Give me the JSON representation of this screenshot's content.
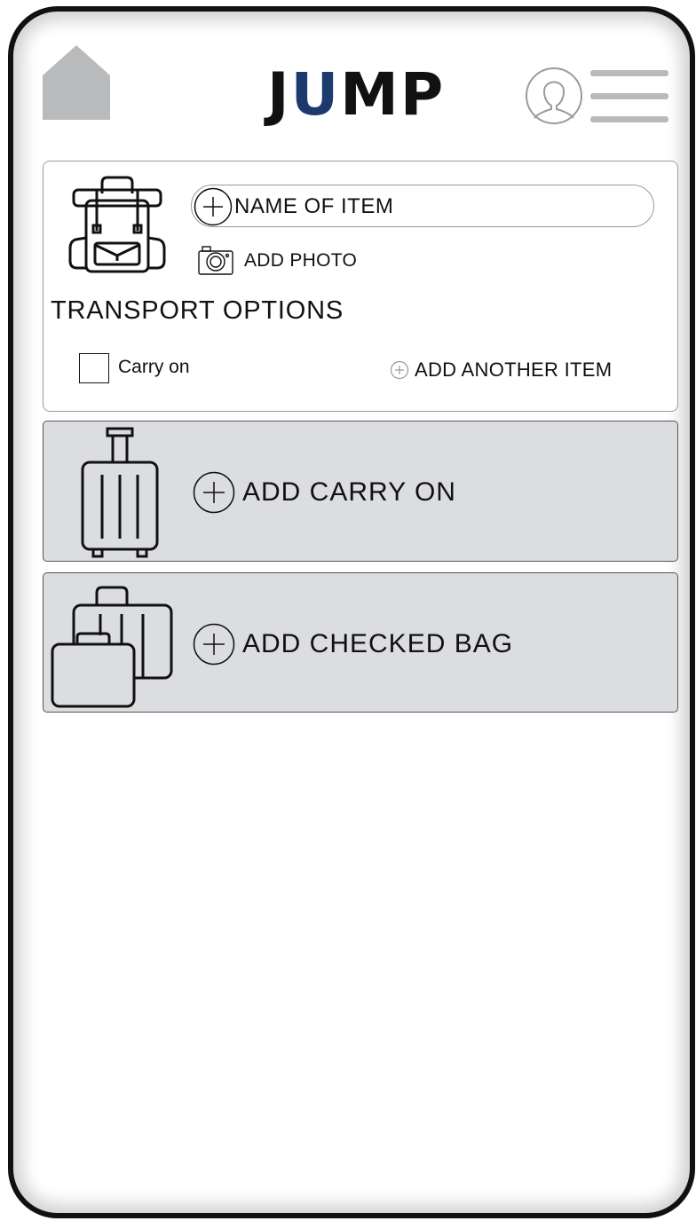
{
  "app": {
    "logo_parts": [
      "J",
      "U",
      "MP"
    ],
    "accent_color": "#1d3a6e"
  },
  "header": {
    "home_icon": "home-icon",
    "profile_icon": "user-profile-icon",
    "menu_icon": "hamburger-menu-icon"
  },
  "item_card": {
    "name_placeholder": "NAME OF ITEM",
    "add_photo_label": "ADD PHOTO",
    "transport_title": "TRANSPORT OPTIONS",
    "carry_on_label": "Carry on",
    "carry_on_checked": false,
    "add_another_label": "ADD ANOTHER ITEM"
  },
  "bags": {
    "carry_on_label": "ADD CARRY ON",
    "checked_label": "ADD CHECKED BAG",
    "card_color": "#dcdde0"
  }
}
